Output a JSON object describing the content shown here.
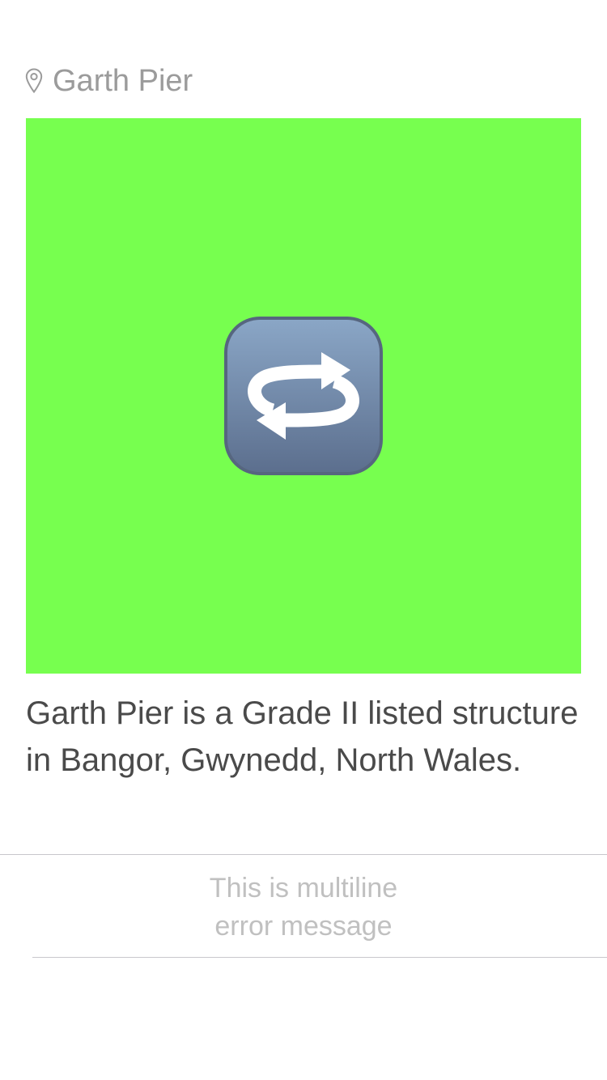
{
  "location": {
    "name": "Garth Pier",
    "icon": "location-pin-icon"
  },
  "media": {
    "background_color": "#77ff4f",
    "icon": "repeat-icon"
  },
  "description": "Garth Pier is a Grade II listed structure in Bangor, Gwynedd, North Wales.",
  "error": {
    "line1": "This is multiline",
    "line2": "error message"
  },
  "colors": {
    "location_text": "#9b9b9b",
    "description_text": "#4a4a4a",
    "error_text": "#c0c0c0",
    "divider": "#c8c7cc"
  }
}
